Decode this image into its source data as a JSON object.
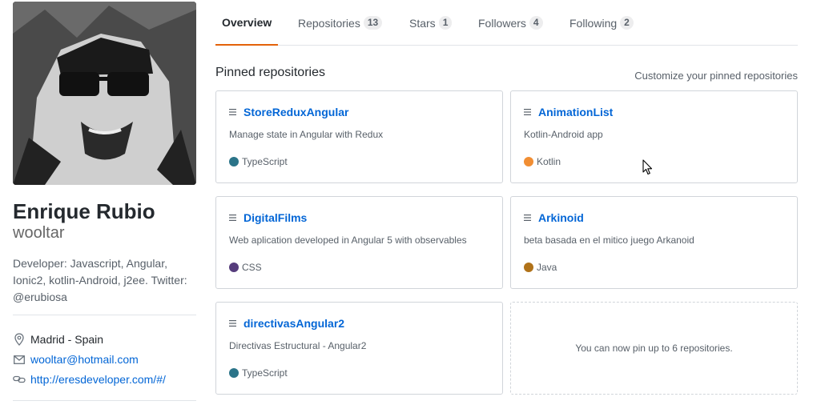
{
  "profile": {
    "fullname": "Enrique Rubio",
    "username": "wooltar",
    "bio": "Developer: Javascript, Angular, Ionic2, kotlin-Android, j2ee. Twitter: @erubiosa",
    "location": "Madrid - Spain",
    "email": "wooltar@hotmail.com",
    "website": "http://eresdeveloper.com/#/",
    "icons": {
      "location": "location-pin-icon",
      "email": "mail-icon",
      "website": "link-icon"
    }
  },
  "tabs": [
    {
      "label": "Overview",
      "count": null,
      "selected": true
    },
    {
      "label": "Repositories",
      "count": "13",
      "selected": false
    },
    {
      "label": "Stars",
      "count": "1",
      "selected": false
    },
    {
      "label": "Followers",
      "count": "4",
      "selected": false
    },
    {
      "label": "Following",
      "count": "2",
      "selected": false
    }
  ],
  "pinned": {
    "title": "Pinned repositories",
    "customize_label": "Customize your pinned repositories",
    "empty_text": "You can now pin up to 6 repositories.",
    "repos": [
      {
        "name": "StoreReduxAngular",
        "description": "Manage state in Angular with Redux",
        "language": "TypeScript",
        "color": "#2b7489"
      },
      {
        "name": "AnimationList",
        "description": "Kotlin-Android app",
        "language": "Kotlin",
        "color": "#F18E33"
      },
      {
        "name": "DigitalFilms",
        "description": "Web aplication developed in Angular 5 with observables",
        "language": "CSS",
        "color": "#563d7c"
      },
      {
        "name": "Arkinoid",
        "description": "beta basada en el mitico juego Arkanoid",
        "language": "Java",
        "color": "#b07219"
      },
      {
        "name": "directivasAngular2",
        "description": "Directivas Estructural - Angular2",
        "language": "TypeScript",
        "color": "#2b7489"
      }
    ]
  },
  "colors": {
    "accent_tab": "#e36209",
    "link": "#0366d6"
  }
}
